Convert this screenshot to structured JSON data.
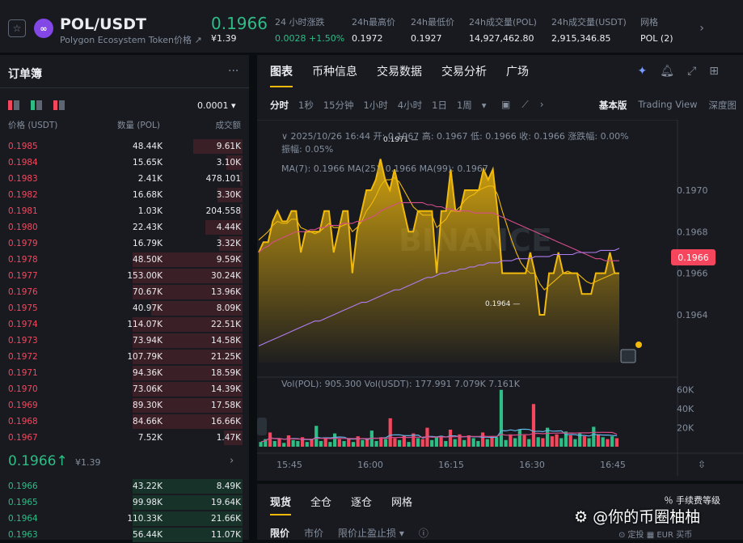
{
  "header": {
    "pair": "POL/USDT",
    "subtitle": "Polygon Ecosystem Token价格 ↗",
    "logo_text": "∞",
    "last_price": "0.1966",
    "last_usd": "¥1.39",
    "stats": [
      {
        "label": "24 小时涨跌",
        "value": "0.0028 +1.50%",
        "color": "#2ebd85"
      },
      {
        "label": "24h最高价",
        "value": "0.1972",
        "color": "#eaecef"
      },
      {
        "label": "24h最低价",
        "value": "0.1927",
        "color": "#eaecef"
      },
      {
        "label": "24h成交量(POL)",
        "value": "14,927,462.80",
        "color": "#eaecef"
      },
      {
        "label": "24h成交量(USDT)",
        "value": "2,915,346.85",
        "color": "#eaecef"
      },
      {
        "label": "网格",
        "value": "POL (2)",
        "color": "#eaecef"
      }
    ],
    "more_label": "›"
  },
  "orderbook": {
    "title": "订单簿",
    "menu": "···",
    "tick_size": "0.0001 ▾",
    "columns": {
      "price": "价格 (USDT)",
      "qty": "数量 (POL)",
      "total": "成交额"
    },
    "asks": [
      {
        "price": "0.1985",
        "qty": "48.44K",
        "total": "9.61K",
        "depth": 0.45
      },
      {
        "price": "0.1984",
        "qty": "15.65K",
        "total": "3.10K",
        "depth": 0.15
      },
      {
        "price": "0.1983",
        "qty": "2.41K",
        "total": "478.101",
        "depth": 0.02
      },
      {
        "price": "0.1982",
        "qty": "16.68K",
        "total": "3.30K",
        "depth": 0.23
      },
      {
        "price": "0.1981",
        "qty": "1.03K",
        "total": "204.558",
        "depth": 0.02
      },
      {
        "price": "0.1980",
        "qty": "22.43K",
        "total": "4.44K",
        "depth": 0.34
      },
      {
        "price": "0.1979",
        "qty": "16.79K",
        "total": "3.32K",
        "depth": 0.21
      },
      {
        "price": "0.1978",
        "qty": "48.50K",
        "total": "9.59K",
        "depth": 1.0
      },
      {
        "price": "0.1977",
        "qty": "153.00K",
        "total": "30.24K",
        "depth": 1.0
      },
      {
        "price": "0.1976",
        "qty": "70.67K",
        "total": "13.96K",
        "depth": 1.0
      },
      {
        "price": "0.1975",
        "qty": "40.97K",
        "total": "8.09K",
        "depth": 0.83
      },
      {
        "price": "0.1974",
        "qty": "114.07K",
        "total": "22.51K",
        "depth": 1.0
      },
      {
        "price": "0.1973",
        "qty": "73.94K",
        "total": "14.58K",
        "depth": 1.0
      },
      {
        "price": "0.1972",
        "qty": "107.79K",
        "total": "21.25K",
        "depth": 1.0
      },
      {
        "price": "0.1971",
        "qty": "94.36K",
        "total": "18.59K",
        "depth": 1.0
      },
      {
        "price": "0.1970",
        "qty": "73.06K",
        "total": "14.39K",
        "depth": 1.0
      },
      {
        "price": "0.1969",
        "qty": "89.30K",
        "total": "17.58K",
        "depth": 1.0
      },
      {
        "price": "0.1968",
        "qty": "84.66K",
        "total": "16.66K",
        "depth": 1.0
      },
      {
        "price": "0.1967",
        "qty": "7.52K",
        "total": "1.47K",
        "depth": 0.17
      }
    ],
    "mid_price": "0.1966↑",
    "mid_usd": "¥1.39",
    "bids": [
      {
        "price": "0.1966",
        "qty": "43.22K",
        "total": "8.49K",
        "depth": 1.0
      },
      {
        "price": "0.1965",
        "qty": "99.98K",
        "total": "19.64K",
        "depth": 1.0
      },
      {
        "price": "0.1964",
        "qty": "110.33K",
        "total": "21.66K",
        "depth": 1.0
      },
      {
        "price": "0.1963",
        "qty": "56.44K",
        "total": "11.07K",
        "depth": 1.0
      }
    ]
  },
  "chart": {
    "tabs": [
      "图表",
      "币种信息",
      "交易数据",
      "交易分析",
      "广场"
    ],
    "intervals": [
      "分时",
      "1秒",
      "15分钟",
      "1小时",
      "4小时",
      "1日",
      "1周",
      "▾"
    ],
    "views": [
      "基本版",
      "Trading View",
      "深度图"
    ],
    "ohlc_text": "∨  2025/10/26 16:44  开: 0.1967  高: 0.1967  低: 0.1966  收: 0.1966  涨跌幅: 0.00%",
    "amp_text": "振幅: 0.05%",
    "ma_text": "MA(7): 0.1966  MA(25): 0.1966  MA(99): 0.1967",
    "vol_text": "Vol(POL): 905.300  Vol(USDT): 177.991  7.079K  7.161K",
    "current_price_tag": "0.1966",
    "watermark": "BINANCE",
    "high_label": "0.1971",
    "low_label": "0.1964"
  },
  "chart_data": {
    "type": "area",
    "title": "",
    "xlabel": "",
    "ylabel": "",
    "x_ticks": [
      "15:45",
      "16:00",
      "16:15",
      "16:30",
      "16:45"
    ],
    "y_ticks": [
      "0.1970",
      "0.1968",
      "0.1966",
      "0.1964"
    ],
    "ylim": [
      0.19617,
      0.1973
    ],
    "series": [
      {
        "name": "",
        "color": "#f0b90b",
        "values": [
          0.1967,
          0.19675,
          0.19675,
          0.19685,
          0.1969,
          0.19685,
          0.19685,
          0.1969,
          0.1969,
          0.1967,
          0.1968,
          0.1968,
          0.1968,
          0.1968,
          0.1969,
          0.1969,
          0.1967,
          0.1968,
          0.1969,
          0.1969,
          0.1966,
          0.1968,
          0.1969,
          0.197,
          0.197,
          0.19705,
          0.19715,
          0.19705,
          0.197,
          0.1971,
          0.197,
          0.1969,
          0.1968,
          0.1968,
          0.1969,
          0.1969,
          0.1969,
          0.1969,
          0.1966,
          0.1969,
          0.1969,
          0.1971,
          0.1969,
          0.1969,
          0.197,
          0.197,
          0.197,
          0.197,
          0.1971,
          0.19705,
          0.1971,
          0.1969,
          0.1966,
          0.1966,
          0.1966,
          0.1966,
          0.1966,
          0.1966,
          0.1967,
          0.1966,
          0.1964,
          0.1964,
          0.1966,
          0.1966,
          0.1967,
          0.1966,
          0.1966,
          0.1966,
          0.1966,
          0.1965,
          0.1965,
          0.1965,
          0.1966,
          0.1966,
          0.1966,
          0.1967,
          0.1966,
          0.1966
        ]
      },
      {
        "name": "MA(7)",
        "color": "#f0b90b",
        "values": [
          0.19676,
          0.19678,
          0.1968,
          0.19683,
          0.19685,
          0.19684,
          0.19684,
          0.19686,
          0.19686,
          0.19682,
          0.19681,
          0.1968,
          0.19679,
          0.1968,
          0.19682,
          0.19684,
          0.19682,
          0.19682,
          0.19683,
          0.19684,
          0.1968,
          0.19682,
          0.19685,
          0.1969,
          0.19693,
          0.19697,
          0.19702,
          0.19705,
          0.19705,
          0.19706,
          0.19704,
          0.197,
          0.19696,
          0.19692,
          0.1969,
          0.19688,
          0.19688,
          0.19688,
          0.19682,
          0.19684,
          0.19686,
          0.1969,
          0.1969,
          0.19692,
          0.19695,
          0.19697,
          0.19698,
          0.197,
          0.19701,
          0.19702,
          0.19702,
          0.19698,
          0.1969,
          0.19683,
          0.19676,
          0.1967,
          0.19665,
          0.19662,
          0.1966,
          0.1966,
          0.19655,
          0.19652,
          0.19654,
          0.19656,
          0.19658,
          0.1966,
          0.19661,
          0.1966,
          0.1966,
          0.19658,
          0.19656,
          0.19655,
          0.19656,
          0.19657,
          0.19658,
          0.19659,
          0.1966,
          0.1966
        ]
      },
      {
        "name": "MA(25)",
        "color": "#d64d8a",
        "values": [
          0.1967,
          0.19672,
          0.19673,
          0.19675,
          0.19676,
          0.19677,
          0.19678,
          0.19679,
          0.1968,
          0.1968,
          0.1968,
          0.19681,
          0.19681,
          0.19682,
          0.19682,
          0.19683,
          0.19683,
          0.19683,
          0.19684,
          0.19684,
          0.19684,
          0.19685,
          0.19685,
          0.19686,
          0.19687,
          0.19688,
          0.1969,
          0.19691,
          0.19692,
          0.19693,
          0.19694,
          0.19694,
          0.19694,
          0.19694,
          0.19694,
          0.19694,
          0.19693,
          0.19693,
          0.19692,
          0.19692,
          0.19691,
          0.19691,
          0.1969,
          0.1969,
          0.1969,
          0.1969,
          0.19689,
          0.19689,
          0.19689,
          0.19689,
          0.19689,
          0.19688,
          0.19687,
          0.19686,
          0.19685,
          0.19684,
          0.19683,
          0.19682,
          0.19681,
          0.1968,
          0.19679,
          0.19678,
          0.19677,
          0.19676,
          0.19675,
          0.19674,
          0.19673,
          0.19672,
          0.19671,
          0.1967,
          0.19669,
          0.19668,
          0.19667,
          0.19667,
          0.19666,
          0.19666,
          0.19666,
          0.19666
        ]
      },
      {
        "name": "MA(99)",
        "color": "#b07cf0",
        "values": [
          0.19625,
          0.19626,
          0.19627,
          0.19628,
          0.19629,
          0.1963,
          0.19631,
          0.19632,
          0.19633,
          0.19634,
          0.19635,
          0.19636,
          0.19637,
          0.19637,
          0.19638,
          0.19639,
          0.1964,
          0.19641,
          0.19642,
          0.19643,
          0.19644,
          0.19645,
          0.19646,
          0.19646,
          0.19647,
          0.19648,
          0.19649,
          0.1965,
          0.19651,
          0.19652,
          0.19652,
          0.19653,
          0.19654,
          0.19655,
          0.19656,
          0.19657,
          0.19658,
          0.19658,
          0.19659,
          0.1966,
          0.1966,
          0.19661,
          0.19661,
          0.19662,
          0.19662,
          0.19663,
          0.19663,
          0.19664,
          0.19664,
          0.19665,
          0.19665,
          0.19665,
          0.19666,
          0.19666,
          0.19666,
          0.19667,
          0.19667,
          0.19667,
          0.19667,
          0.19668,
          0.19668,
          0.19668,
          0.19668,
          0.19669,
          0.19669,
          0.19669,
          0.19669,
          0.19669,
          0.1967,
          0.1967,
          0.1967,
          0.1967,
          0.1967,
          0.19671,
          0.19671,
          0.19671,
          0.19671,
          0.19672
        ]
      }
    ],
    "volume": {
      "y_ticks": [
        "60K",
        "40K",
        "20K"
      ],
      "ymax": 70000,
      "bars": [
        5000,
        8000,
        15000,
        6000,
        9000,
        4000,
        12000,
        7000,
        6000,
        10000,
        5000,
        8000,
        22000,
        6000,
        9000,
        5000,
        14000,
        8000,
        6000,
        9000,
        5000,
        11000,
        7000,
        8000,
        17000,
        6000,
        10000,
        8000,
        30000,
        9000,
        7000,
        12000,
        5000,
        14000,
        9000,
        8000,
        20000,
        7000,
        10000,
        11000,
        6000,
        18000,
        8000,
        13000,
        7000,
        12000,
        9000,
        6000,
        15000,
        8000,
        11000,
        10000,
        60000,
        7000,
        13000,
        9000,
        18000,
        12000,
        8000,
        45000,
        10000,
        9000,
        20000,
        11000,
        13000,
        9000,
        16000,
        12000,
        8000,
        14000,
        11000,
        9000,
        21000,
        13000,
        10000,
        8000,
        11000,
        9000
      ],
      "colors": [
        "g",
        "g",
        "r",
        "g",
        "r",
        "g",
        "r",
        "g",
        "g",
        "r",
        "g",
        "r",
        "g",
        "g",
        "r",
        "g",
        "g",
        "r",
        "g",
        "r",
        "g",
        "r",
        "g",
        "r",
        "g",
        "g",
        "r",
        "g",
        "r",
        "r",
        "g",
        "r",
        "g",
        "r",
        "g",
        "r",
        "r",
        "g",
        "g",
        "r",
        "g",
        "r",
        "g",
        "r",
        "g",
        "r",
        "g",
        "g",
        "r",
        "g",
        "r",
        "g",
        "g",
        "g",
        "r",
        "g",
        "g",
        "r",
        "g",
        "r",
        "g",
        "r",
        "g",
        "r",
        "r",
        "g",
        "g",
        "r",
        "g",
        "g",
        "r",
        "g",
        "g",
        "r",
        "g",
        "r",
        "g",
        "r"
      ]
    }
  },
  "trade": {
    "tabs": [
      "现货",
      "全仓",
      "逐仓",
      "网格"
    ],
    "fee": "％  手续费等级",
    "order_tabs": [
      "限价",
      "市价",
      "限价止盈止损 ▾",
      "ⓘ"
    ]
  },
  "watermark": {
    "text": "⚙ @你的币圈柚柚",
    "small": "⊙ 定投    ▦ EUR 买币"
  }
}
